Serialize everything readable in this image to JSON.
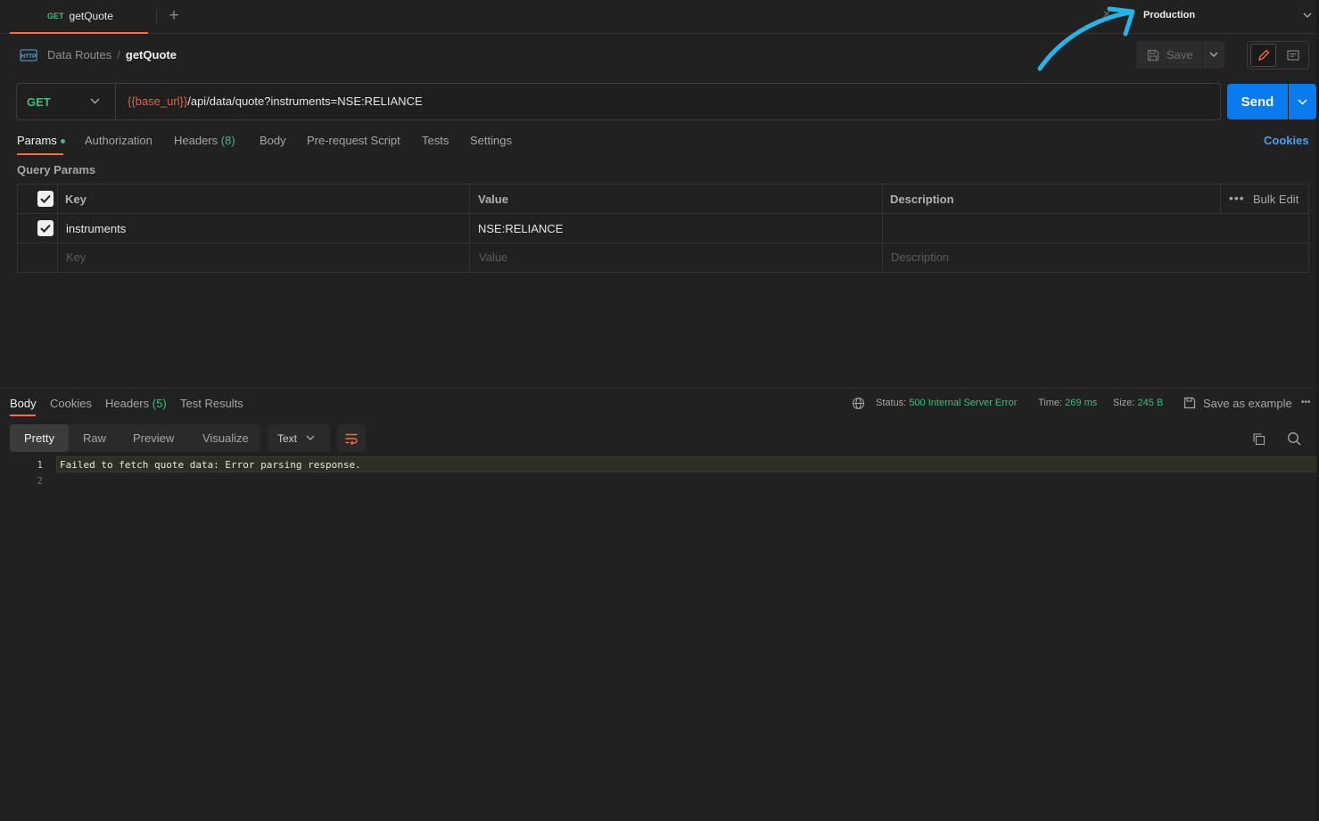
{
  "tab": {
    "method": "GET",
    "name": "getQuote"
  },
  "environment": {
    "name": "Production"
  },
  "breadcrumb": {
    "collection": "Data Routes",
    "separator": "/",
    "request": "getQuote"
  },
  "toolbar": {
    "save_label": "Save"
  },
  "request": {
    "method": "GET",
    "url_variable": "{{base_url}}",
    "url_path": "/api/data/quote?instruments=NSE:RELIANCE",
    "send_label": "Send"
  },
  "request_tabs": {
    "params": "Params",
    "authorization": "Authorization",
    "headers": "Headers",
    "headers_count": "(8)",
    "body": "Body",
    "prerequest": "Pre-request Script",
    "tests": "Tests",
    "settings": "Settings",
    "cookies": "Cookies"
  },
  "query_params": {
    "title": "Query Params",
    "columns": {
      "key": "Key",
      "value": "Value",
      "description": "Description"
    },
    "bulk_edit": "Bulk Edit",
    "more": "•••",
    "rows": [
      {
        "checked": true,
        "key": "instruments",
        "value": "NSE:RELIANCE",
        "description": ""
      }
    ],
    "placeholders": {
      "key": "Key",
      "value": "Value",
      "description": "Description"
    }
  },
  "response": {
    "tabs": {
      "body": "Body",
      "cookies": "Cookies",
      "headers": "Headers",
      "headers_count": "(5)",
      "test_results": "Test Results"
    },
    "status_label": "Status:",
    "status_value": "500 Internal Server Error",
    "time_label": "Time:",
    "time_value": "269 ms",
    "size_label": "Size:",
    "size_value": "245 B",
    "save_example": "Save as example",
    "more": "•••",
    "formats": {
      "pretty": "Pretty",
      "raw": "Raw",
      "preview": "Preview",
      "visualize": "Visualize"
    },
    "text_type": "Text",
    "lines": [
      {
        "num": "1",
        "text": "Failed to fetch quote data: Error parsing response."
      },
      {
        "num": "2",
        "text": ""
      }
    ]
  },
  "colors": {
    "accent": "#ff6c37",
    "send": "#097bed",
    "success": "#49b87b",
    "annotation": "#27b4e6"
  }
}
